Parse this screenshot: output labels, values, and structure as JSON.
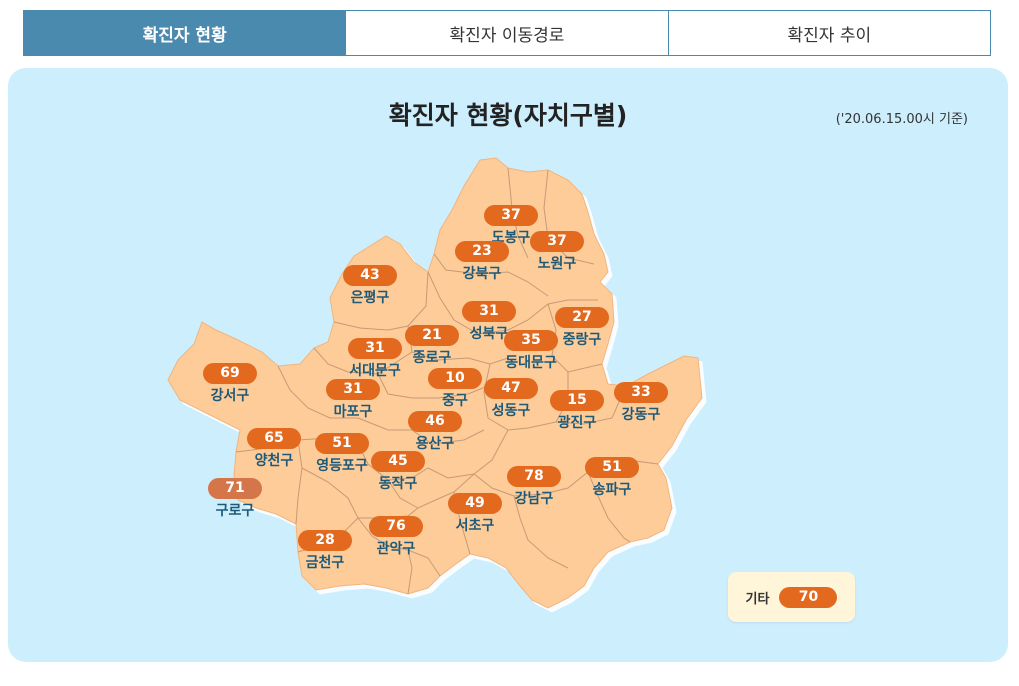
{
  "tabs": [
    {
      "label": "확진자 현황",
      "active": true
    },
    {
      "label": "확진자 이동경로",
      "active": false
    },
    {
      "label": "확진자 추이",
      "active": false
    }
  ],
  "title": "확진자 현황(자치구별)",
  "as_of": "('20.06.15.00시 기준)",
  "colors": {
    "accent": "#4a8aae",
    "panel": "#cdeefd",
    "land": "#fdcc99",
    "pill": "#e2691e",
    "label": "#1e5a78"
  },
  "districts": [
    {
      "name": "도봉구",
      "count": "37"
    },
    {
      "name": "노원구",
      "count": "37"
    },
    {
      "name": "강북구",
      "count": "23"
    },
    {
      "name": "은평구",
      "count": "43"
    },
    {
      "name": "성북구",
      "count": "31"
    },
    {
      "name": "중랑구",
      "count": "27"
    },
    {
      "name": "종로구",
      "count": "21"
    },
    {
      "name": "동대문구",
      "count": "35"
    },
    {
      "name": "서대문구",
      "count": "31"
    },
    {
      "name": "강서구",
      "count": "69"
    },
    {
      "name": "중구",
      "count": "10"
    },
    {
      "name": "마포구",
      "count": "31"
    },
    {
      "name": "성동구",
      "count": "47"
    },
    {
      "name": "광진구",
      "count": "15"
    },
    {
      "name": "강동구",
      "count": "33"
    },
    {
      "name": "용산구",
      "count": "46"
    },
    {
      "name": "양천구",
      "count": "65"
    },
    {
      "name": "영등포구",
      "count": "51"
    },
    {
      "name": "동작구",
      "count": "45"
    },
    {
      "name": "강남구",
      "count": "78"
    },
    {
      "name": "송파구",
      "count": "51"
    },
    {
      "name": "구로구",
      "count": "71"
    },
    {
      "name": "서초구",
      "count": "49"
    },
    {
      "name": "관악구",
      "count": "76"
    },
    {
      "name": "금천구",
      "count": "28"
    }
  ],
  "other": {
    "label": "기타",
    "count": "70"
  }
}
